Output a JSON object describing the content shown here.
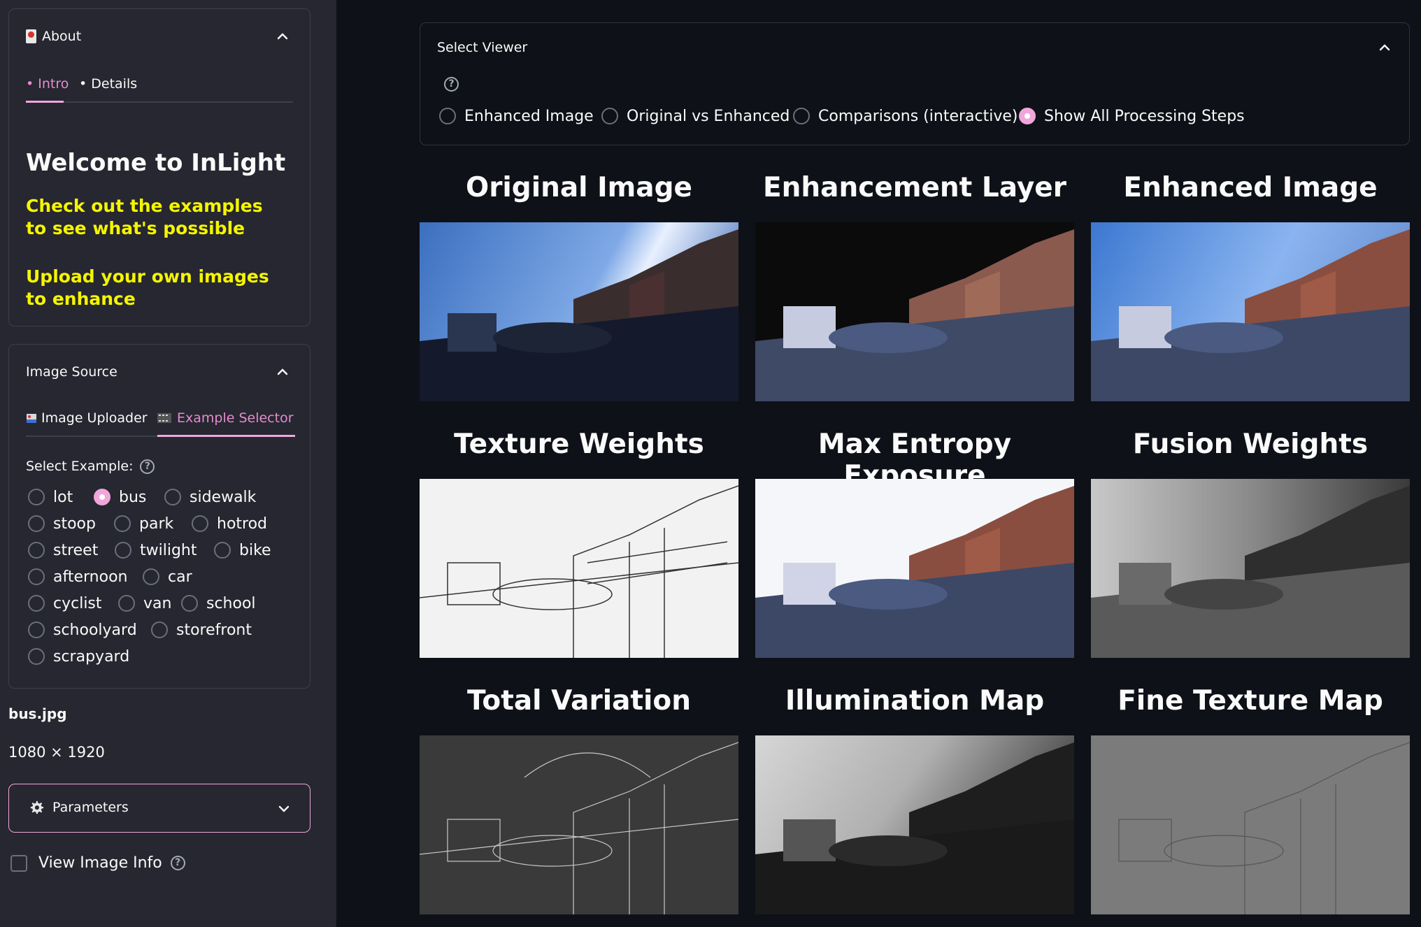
{
  "sidebar": {
    "about": {
      "title": "About",
      "tabs": [
        "Intro",
        "Details"
      ],
      "welcome": "Welcome to InLight",
      "line1": "Check out the examples to see what's possible",
      "line2": "Upload your own images to enhance"
    },
    "image_source": {
      "title": "Image Source",
      "tabs": [
        "Image Uploader",
        "Example Selector"
      ],
      "select_label": "Select Example:",
      "examples": [
        "lot",
        "bus",
        "sidewalk",
        "stoop",
        "park",
        "hotrod",
        "street",
        "twilight",
        "bike",
        "afternoon",
        "car",
        "cyclist",
        "van",
        "school",
        "schoolyard",
        "storefront",
        "scrapyard"
      ],
      "selected": "bus"
    },
    "file_name": "bus.jpg",
    "file_dims": "1080 × 1920",
    "parameters_label": "Parameters",
    "view_info_label": "View Image Info"
  },
  "main": {
    "viewer_title": "Select Viewer",
    "viewer_options": [
      "Enhanced Image",
      "Original vs Enhanced",
      "Comparisons (interactive)",
      "Show All Processing Steps"
    ],
    "viewer_selected": "Show All Processing Steps",
    "panels": [
      "Original Image",
      "Enhancement Layer",
      "Enhanced Image",
      "Texture Weights",
      "Max Entropy Exposure",
      "Fusion Weights",
      "Total Variation",
      "Illumination Map",
      "Fine Texture Map"
    ]
  },
  "colors": {
    "accent": "#f0a6da",
    "highlight": "#f5f500",
    "background": "#0e1117",
    "sidebar": "#262730"
  }
}
